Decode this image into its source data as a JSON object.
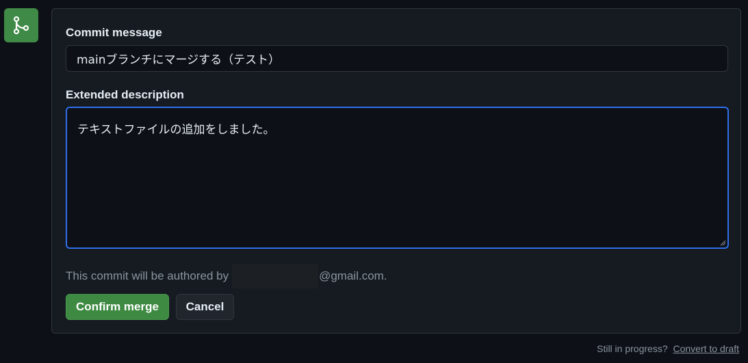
{
  "icon": {
    "name": "git-merge-icon",
    "color": "#3f8a46"
  },
  "form": {
    "commit_label": "Commit message",
    "commit_value": "mainブランチにマージする（テスト）",
    "description_label": "Extended description",
    "description_value": "テキストファイルの追加をしました。",
    "author_prefix": "This commit will be authored by",
    "author_suffix": "@gmail.com.",
    "confirm_label": "Confirm merge",
    "cancel_label": "Cancel"
  },
  "footer": {
    "prompt": "Still in progress?",
    "link": "Convert to draft"
  },
  "colors": {
    "background": "#0d1117",
    "panel": "#161b22",
    "accent_green": "#3e8a42",
    "focus_blue": "#2f6feb"
  }
}
